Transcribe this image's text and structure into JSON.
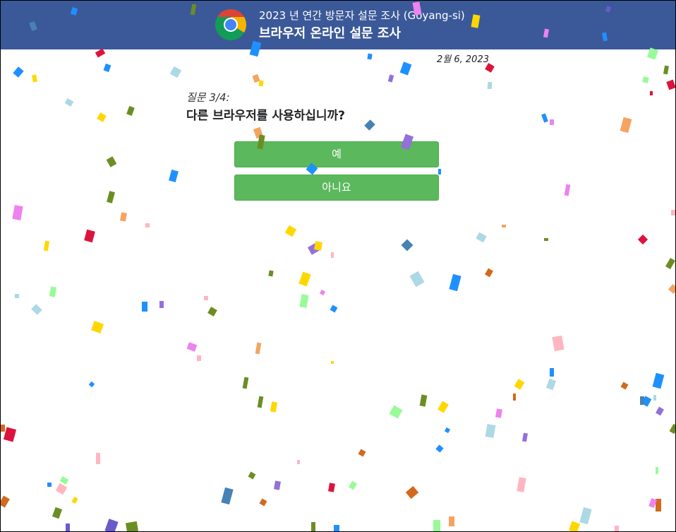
{
  "header": {
    "subtitle": "2023 년 연간 방문자 설문 조사 (Goyang-si)",
    "title": "브라우저 온라인 설문 조사",
    "logo_icon": "chrome-logo-icon"
  },
  "date": "2월 6, 2023",
  "question": {
    "number": "질문 3/4:",
    "text": "다른 브라우저를 사용하십니까?"
  },
  "answers": [
    {
      "label": "예"
    },
    {
      "label": "아니요"
    }
  ],
  "colors": {
    "header_bg": "#3b5998",
    "button_bg": "#5cb85c",
    "confetti": [
      "#1e90ff",
      "#ffd700",
      "#dc143c",
      "#6b8e23",
      "#9370db",
      "#ee82ee",
      "#98fb98",
      "#add8e6",
      "#f4a460",
      "#4682b4",
      "#ffb6c1",
      "#d2691e",
      "#6a5acd"
    ]
  }
}
